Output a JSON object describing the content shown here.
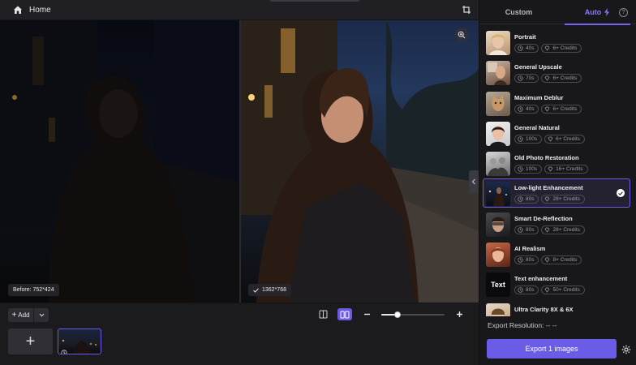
{
  "topbar": {
    "home_label": "Home"
  },
  "canvas": {
    "before_label": "Before: 752*424",
    "after_label": "1362*768"
  },
  "bottom": {
    "add_label": "Add",
    "zoom_level": 0.25
  },
  "panel": {
    "tabs": [
      {
        "label": "Custom"
      },
      {
        "label": "Auto"
      }
    ],
    "models": [
      {
        "name": "Portrait",
        "time": "40s",
        "credits": "6+ Credits"
      },
      {
        "name": "General Upscale",
        "time": "70s",
        "credits": "6+ Credits"
      },
      {
        "name": "Maximum Deblur",
        "time": "40s",
        "credits": "6+ Credits"
      },
      {
        "name": "General Natural",
        "time": "100s",
        "credits": "6+ Credits"
      },
      {
        "name": "Old Photo Restoration",
        "time": "100s",
        "credits": "16+ Credits"
      },
      {
        "name": "Low-light Enhancement",
        "time": "80s",
        "credits": "28+ Credits"
      },
      {
        "name": "Smart De-Reflection",
        "time": "80s",
        "credits": "28+ Credits"
      },
      {
        "name": "AI Realism",
        "time": "80s",
        "credits": "8+ Credits"
      },
      {
        "name": "Text enhancement",
        "time": "80s",
        "credits": "50+ Credits"
      },
      {
        "name": "Ultra Clarity 8X & 6X",
        "time": "",
        "credits": ""
      }
    ],
    "text_thumb_label": "Text",
    "export_resolution": "Export Resolution: -- --",
    "export_button": "Export 1 images"
  },
  "colors": {
    "accent": "#6b5ce8",
    "accent_text": "#8b7bff",
    "background": "#1d1d20"
  }
}
